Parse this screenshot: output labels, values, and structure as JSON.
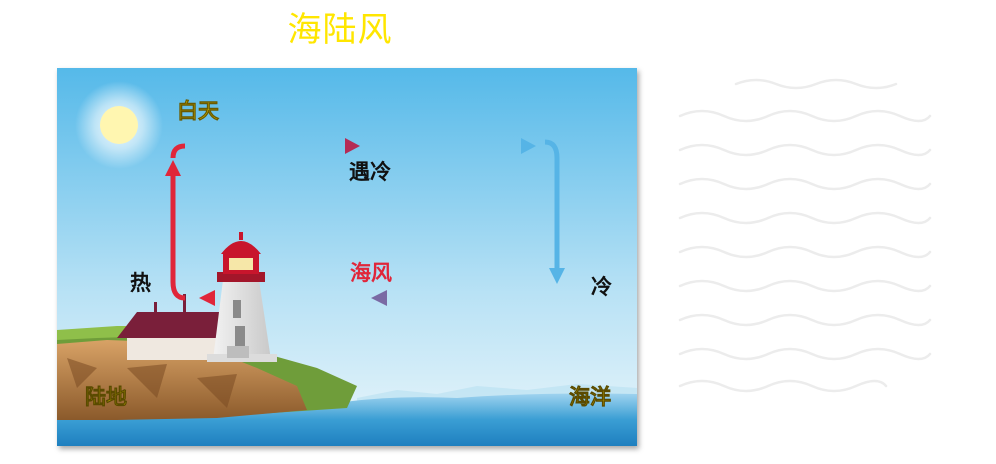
{
  "title": "海陆风",
  "diagram": {
    "labels": {
      "daytime": "白天",
      "meets_cold": "遇冷",
      "hot": "热",
      "sea_breeze": "海风",
      "cold": "冷",
      "land": "陆地",
      "ocean": "海洋"
    },
    "colors": {
      "warm_arrow": "#e0263a",
      "cool_arrow": "#56b4e6",
      "blend_arrow": "#7a6aa4",
      "sky_top": "#55b9e9",
      "sky_bottom": "#eaf6fb",
      "sun": "#fff6b0",
      "sea": "#3a9ed4",
      "roof": "#7a1f3a",
      "lighthouse_top": "#c8152c"
    }
  }
}
